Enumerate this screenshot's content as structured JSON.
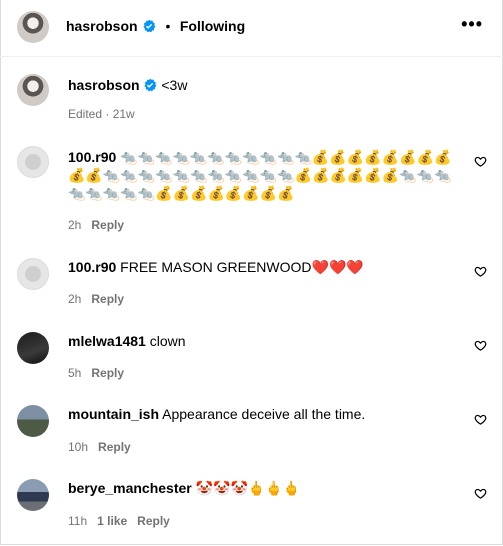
{
  "header": {
    "username": "hasrobson",
    "separator": "•",
    "following_label": "Following",
    "more_icon": "more-horizontal-icon"
  },
  "caption": {
    "username": "hasrobson",
    "text": "<3w",
    "meta": "Edited · 21w"
  },
  "comments": [
    {
      "username": "100.r90",
      "text": "🐀🐀🐀🐀🐀🐀🐀🐀🐀🐀🐀💰💰💰💰💰💰💰💰💰💰🐀🐀🐀🐀🐀🐀🐀🐀🐀🐀🐀💰💰💰💰💰💰🐀🐀🐀🐀🐀🐀🐀🐀💰💰💰💰💰💰💰💰",
      "time": "2h",
      "likes": "",
      "reply_label": "Reply"
    },
    {
      "username": "100.r90",
      "text": "FREE MASON GREENWOOD❤️❤️❤️",
      "time": "2h",
      "likes": "",
      "reply_label": "Reply"
    },
    {
      "username": "mlelwa1481",
      "text": "clown",
      "time": "5h",
      "likes": "",
      "reply_label": "Reply"
    },
    {
      "username": "mountain_ish",
      "text": "Appearance deceive all the time.",
      "time": "10h",
      "likes": "",
      "reply_label": "Reply"
    },
    {
      "username": "berye_manchester",
      "text": "🤡🤡🤡🖕🖕🖕",
      "time": "11h",
      "likes": "1 like",
      "reply_label": "Reply"
    }
  ],
  "colors": {
    "verified": "#0095f6",
    "muted": "#737373",
    "border": "#dbdbdb"
  }
}
